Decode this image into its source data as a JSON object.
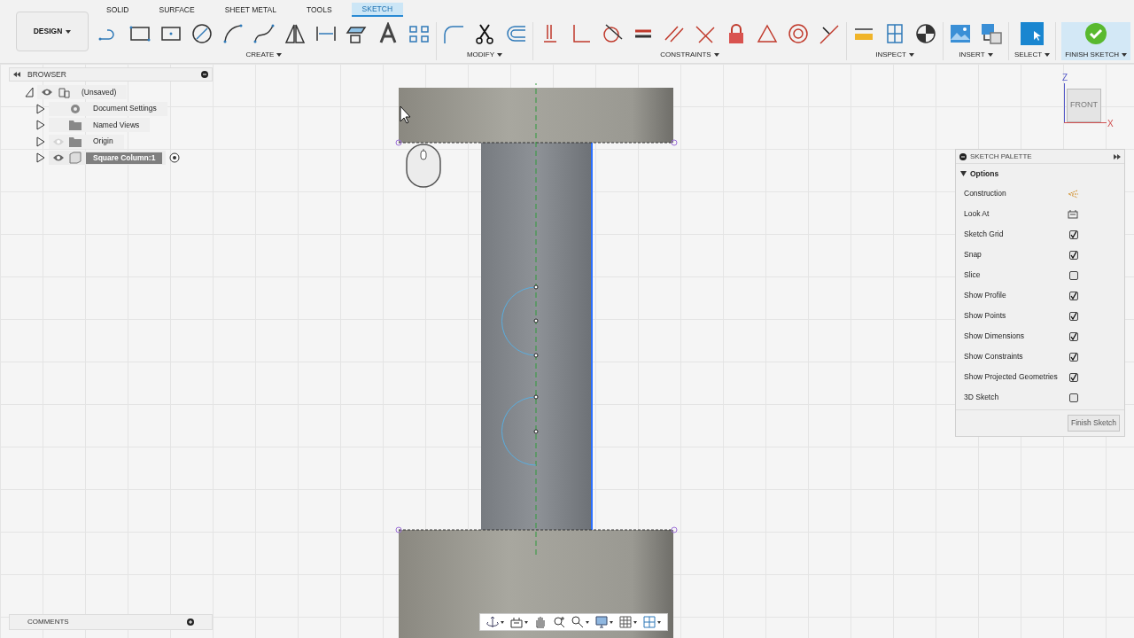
{
  "toolbar": {
    "workspace": "DESIGN",
    "tabs": [
      {
        "label": "SOLID",
        "selected": false
      },
      {
        "label": "SURFACE",
        "selected": false
      },
      {
        "label": "SHEET METAL",
        "selected": false
      },
      {
        "label": "TOOLS",
        "selected": false
      },
      {
        "label": "SKETCH",
        "selected": true
      }
    ],
    "groups": [
      {
        "kind": "create",
        "label": "CREATE"
      },
      {
        "kind": "modify",
        "label": "MODIFY"
      },
      {
        "kind": "constraints",
        "label": "CONSTRAINTS"
      },
      {
        "kind": "inspect",
        "label": "INSPECT"
      },
      {
        "kind": "insert",
        "label": "INSERT"
      },
      {
        "kind": "select",
        "label": "SELECT"
      },
      {
        "kind": "finish",
        "label": "FINISH SKETCH"
      }
    ]
  },
  "browser": {
    "title": "BROWSER",
    "tree": {
      "label": "(Unsaved)",
      "kind": "component",
      "visible": true,
      "expanded": true,
      "selected": false,
      "active": false,
      "children": [
        {
          "label": "Document Settings",
          "kind": "settings",
          "expanded": false,
          "selected": false,
          "active": false
        },
        {
          "label": "Named Views",
          "kind": "views",
          "expanded": false,
          "selected": false,
          "active": false
        },
        {
          "label": "Origin",
          "kind": "origin",
          "visible": false,
          "expanded": false,
          "selected": false,
          "active": false
        },
        {
          "label": "Square Column:1",
          "kind": "body",
          "visible": true,
          "expanded": false,
          "selected": true,
          "active": true
        }
      ]
    }
  },
  "viewcube": {
    "face": "FRONT",
    "z": "Z",
    "x": "X"
  },
  "palette": {
    "title": "SKETCH PALETTE",
    "section": {
      "label": "Options",
      "expanded": true
    },
    "options": [
      {
        "label": "Construction",
        "kind": "construction"
      },
      {
        "label": "Look At",
        "kind": "look-at"
      },
      {
        "label": "Sketch Grid",
        "kind": "checkbox",
        "checked": true
      },
      {
        "label": "Snap",
        "kind": "checkbox",
        "checked": true
      },
      {
        "label": "Slice",
        "kind": "checkbox",
        "checked": false
      },
      {
        "label": "Show Profile",
        "kind": "checkbox",
        "checked": true
      },
      {
        "label": "Show Points",
        "kind": "checkbox",
        "checked": true
      },
      {
        "label": "Show Dimensions",
        "kind": "checkbox",
        "checked": true
      },
      {
        "label": "Show Constraints",
        "kind": "checkbox",
        "checked": true
      },
      {
        "label": "Show Projected Geometries",
        "kind": "checkbox",
        "checked": true
      },
      {
        "label": "3D Sketch",
        "kind": "checkbox",
        "checked": false
      }
    ],
    "button": "Finish Sketch"
  },
  "comments": {
    "title": "COMMENTS"
  }
}
